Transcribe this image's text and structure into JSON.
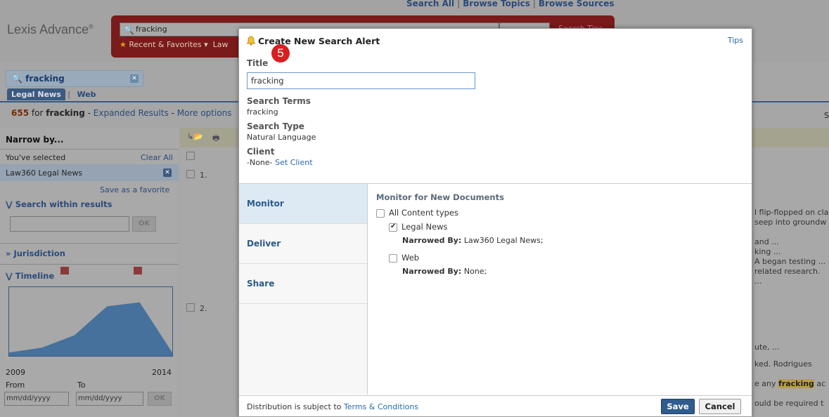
{
  "bg": {
    "top_links": [
      "Search All",
      "Browse Topics",
      "Browse Sources"
    ],
    "logo": "Lexis Advance",
    "logo_mark": "®",
    "search_value": "fracking",
    "search_tips": "Search Tips",
    "recent": "Recent & Favorites",
    "recent_cut": "Law",
    "search_tab": "fracking",
    "content_tab_active": "Legal News",
    "content_tab_web": "Web",
    "results_count": "655",
    "results_for": "for",
    "results_term": "fracking",
    "results_expanded": "Expanded Results",
    "results_more": "More options",
    "narrow_by": "Narrow by...",
    "youve_selected": "You've selected",
    "clear_all": "Clear All",
    "selected_filter": "Law360 Legal News",
    "save_favorite": "Save as a favorite",
    "search_within": "Search within results",
    "ok": "OK",
    "jurisdiction": "Jurisdiction",
    "timeline": "Timeline",
    "year_start": "2009",
    "year_end": "2014",
    "from": "From",
    "to": "To",
    "date_placeholder": "mm/dd/yyyy",
    "row1_num": "1.",
    "row2_num": "2.",
    "snip_right_1": "l flip-flopped on cla",
    "snip_right_2": "seep into groundw",
    "snip_right_3": "and ...",
    "snip_right_4": "king ...",
    "snip_right_5": "A began testing ...",
    "snip_right_6": "related research.",
    "snip_right_7": "...",
    "snip_right_8": "ute, ...",
    "snip_right_9": "ked. Rodrigues",
    "snip_right_10a": "e any ",
    "snip_right_10b": "fracking",
    "snip_right_10c": " ac",
    "snip_right_11": "ould be required t",
    "s_right": "S"
  },
  "modal": {
    "title": "Create New Search Alert",
    "tips": "Tips",
    "step_badge": "5",
    "title_label": "Title",
    "title_value": "fracking",
    "search_terms_label": "Search Terms",
    "search_terms_value": "fracking",
    "search_type_label": "Search Type",
    "search_type_value": "Natural Language",
    "client_label": "Client",
    "client_value": "-None-",
    "set_client": "Set Client",
    "nav": [
      "Monitor",
      "Deliver",
      "Share"
    ],
    "panel_heading": "Monitor for New Documents",
    "options": [
      {
        "label": "All Content types",
        "checked": false
      },
      {
        "label": "Legal News",
        "checked": true,
        "narrowed_label": "Narrowed By:",
        "narrowed_value": "Law360 Legal News;"
      },
      {
        "label": "Web",
        "checked": false,
        "narrowed_label": "Narrowed By:",
        "narrowed_value": "None;"
      }
    ],
    "footer_text": "Distribution is subject to",
    "footer_link": "Terms & Conditions",
    "save": "Save",
    "cancel": "Cancel"
  },
  "timeline_chart": {
    "type": "area",
    "values": [
      0.05,
      0.12,
      0.3,
      0.72,
      0.78,
      0.05
    ],
    "color": "#3a6a9a"
  },
  "colors": {
    "accent": "#2f5b8e",
    "link": "#2a6aaa",
    "badge": "#d62020",
    "search_bar": "#7a1a1a"
  }
}
